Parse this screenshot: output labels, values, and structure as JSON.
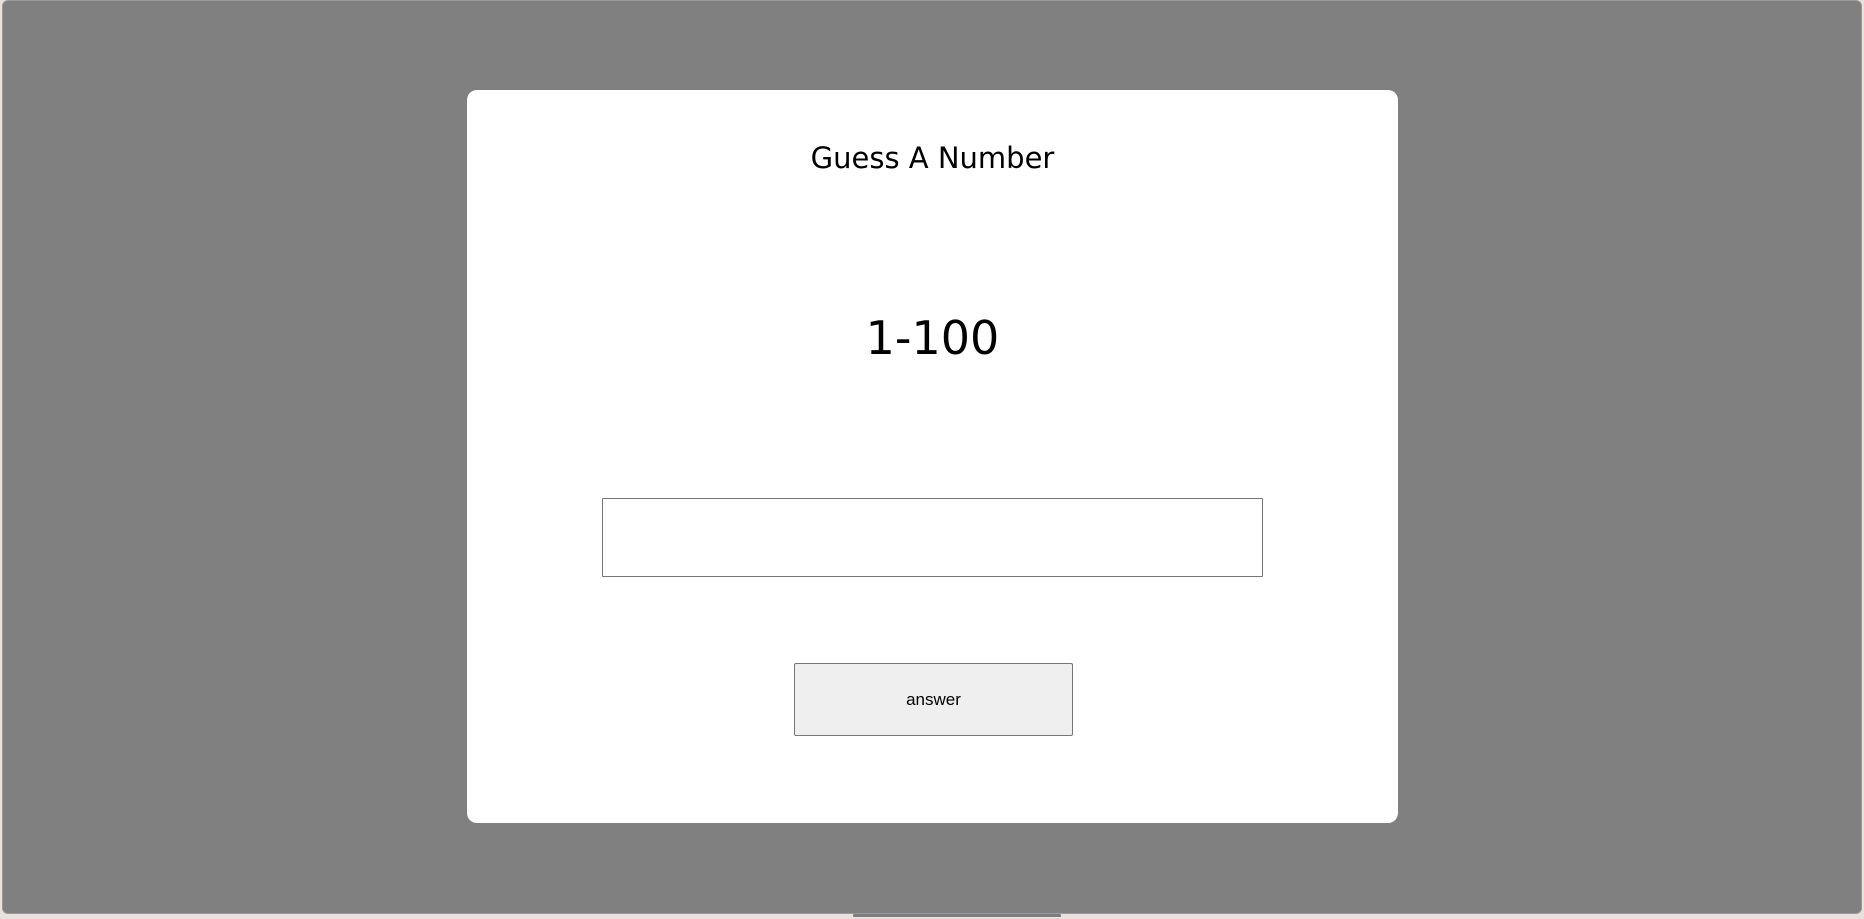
{
  "game": {
    "title": "Guess A Number",
    "range_label": "1-100",
    "guess_input": {
      "value": "",
      "placeholder": ""
    },
    "answer_button_label": "answer"
  },
  "colors": {
    "page_background": "#808080",
    "card_background": "#ffffff",
    "button_background": "#efefef",
    "border": "#767676"
  }
}
